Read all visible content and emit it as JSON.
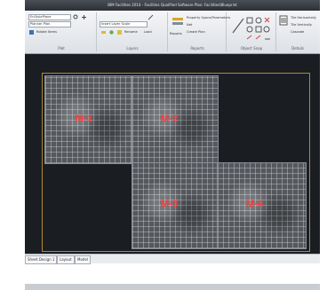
{
  "window": {
    "title": "BIM Facilities 2014 - Facilities Qualified Software Plan: Facilities\\Blueprint"
  },
  "ribbon": {
    "groups": [
      {
        "label": "Plot",
        "controls": [
          "EnStylePlane",
          "Planner Plan",
          "Rotate Items"
        ]
      },
      {
        "label": "Layers",
        "controls": [
          "Insert Layer Scale",
          "Rename",
          "Load"
        ]
      },
      {
        "label": "Reports",
        "controls": [
          "Property Space/Parameters",
          "Net",
          "Create Plan",
          "Reports"
        ]
      },
      {
        "label": "Object Snap",
        "controls": []
      },
      {
        "label": "Details",
        "controls": [
          "Tile Horizontally",
          "Tile Vertically",
          "Cascade"
        ]
      }
    ]
  },
  "sheets": [
    {
      "label": "M-1"
    },
    {
      "label": "M-2"
    },
    {
      "label": "M-3"
    },
    {
      "label": "M-4"
    }
  ],
  "statusbar": {
    "tabs": [
      "Sheet Design 1",
      "Layout",
      "Model"
    ]
  }
}
